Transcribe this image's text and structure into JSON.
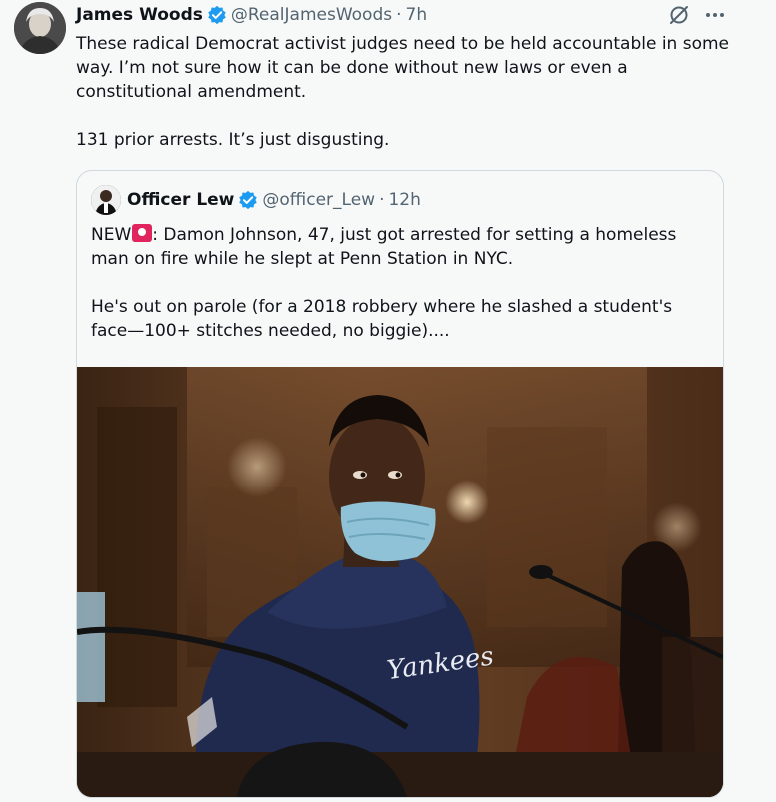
{
  "tweet": {
    "author_name": "James Woods",
    "author_handle": "@RealJamesWoods",
    "separator": "·",
    "timestamp": "7h",
    "paragraphs": [
      "These radical Democrat activist judges need to be held accountable in some way. I’m not sure how it can be done without new laws or even a constitutional amendment.",
      "131 prior arrests. It’s just disgusting."
    ],
    "verified_color": "#1d9bf0"
  },
  "quoted_tweet": {
    "author_name": "Officer Lew",
    "author_handle": "@officer_Lew",
    "separator": "·",
    "timestamp": "12h",
    "prefix": "NEW",
    "headline_rest": ": Damon Johnson, 47, just got arrested for setting a homeless man on fire while he slept at Penn Station in NYC.",
    "paragraph2": "He's out on parole (for a 2018 robbery where he slashed a student's face—100+ stitches needed, no biggie)....",
    "photo_sweatshirt_text": "Yankees"
  },
  "actions": {
    "more_label": "···"
  }
}
